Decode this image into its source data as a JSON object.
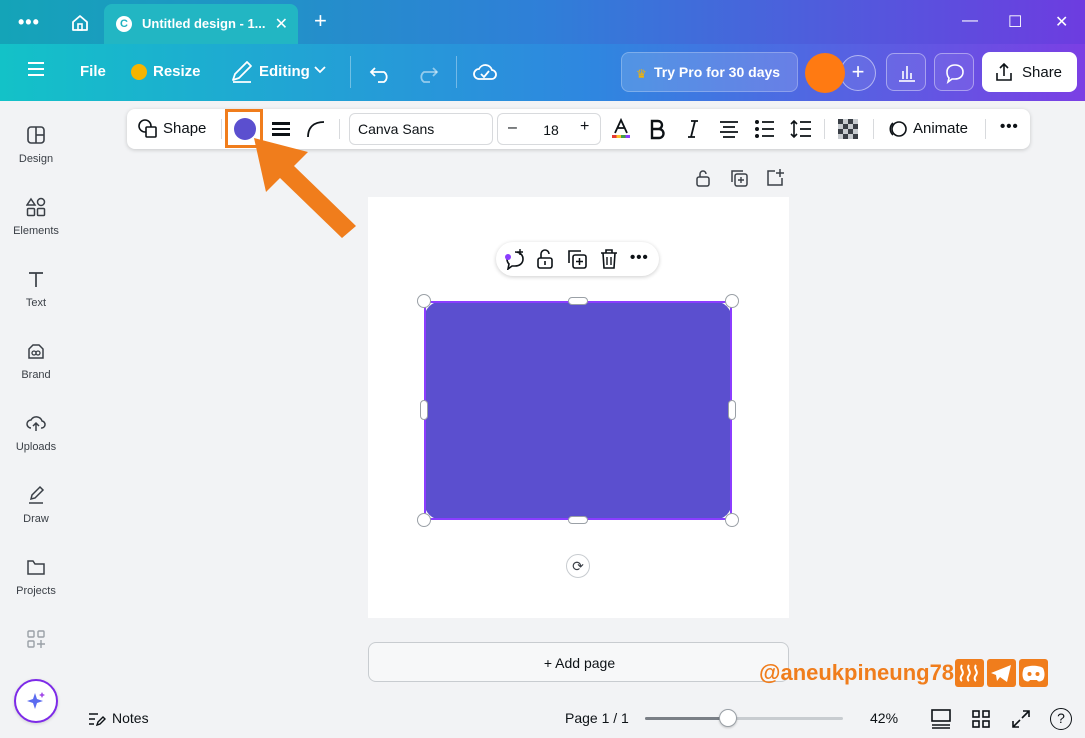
{
  "titlebar": {
    "menu_dots": "•••",
    "tab_title": "Untitled design - 1...",
    "tab_close": "✕",
    "new_tab": "+",
    "window_controls": [
      "—",
      "☐",
      "✕"
    ]
  },
  "header": {
    "file_label": "File",
    "resize_label": "Resize",
    "editing_label": "Editing",
    "try_pro_label": "Try Pro for 30 days",
    "avatar_plus": "+",
    "share_label": "Share"
  },
  "sidebar": {
    "items": [
      {
        "label": "Design",
        "icon": "design-icon"
      },
      {
        "label": "Elements",
        "icon": "elements-icon"
      },
      {
        "label": "Text",
        "icon": "text-icon"
      },
      {
        "label": "Brand",
        "icon": "brand-icon"
      },
      {
        "label": "Uploads",
        "icon": "uploads-icon"
      },
      {
        "label": "Draw",
        "icon": "draw-icon"
      },
      {
        "label": "Projects",
        "icon": "projects-icon"
      }
    ]
  },
  "context_toolbar": {
    "shape_label": "Shape",
    "shape_color": "#5b4fcf",
    "font_name": "Canva Sans",
    "size_minus": "–",
    "font_size": "18",
    "size_plus": "+",
    "animate_label": "Animate",
    "more": "•••"
  },
  "floating_toolbar": {
    "more": "•••"
  },
  "canvas": {
    "add_page_label": "+ Add page",
    "rotate_glyph": "⟳"
  },
  "watermark": {
    "text": "@aneukpineung78"
  },
  "footer": {
    "notes_label": "Notes",
    "page_label": "Page 1 / 1",
    "zoom_label": "42%",
    "zoom_fraction": 0.42,
    "help": "?"
  },
  "colors": {
    "accent_purple": "#8b3dff",
    "shape_fill": "#5b4fcf",
    "annotation_orange": "#f07d1c",
    "avatar_orange": "#ff7a12"
  }
}
